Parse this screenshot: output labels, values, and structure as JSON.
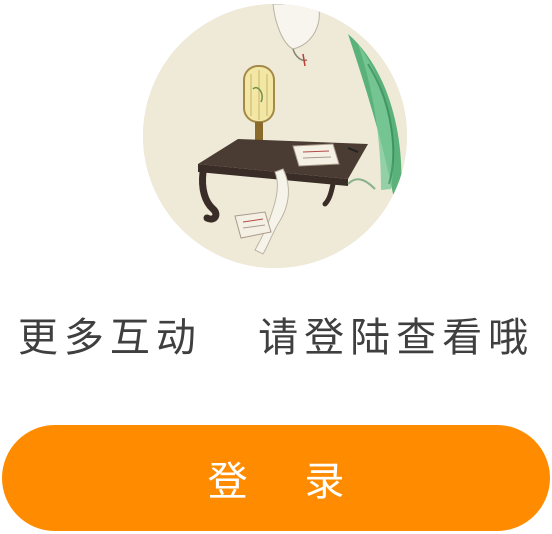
{
  "illustration": {
    "icon": "lantern-desk-illustration",
    "description_hidden": ""
  },
  "prompt": {
    "text": "更多互动   请登陆查看哦"
  },
  "login_button": {
    "label": "登 录",
    "color": "#ff8c00"
  }
}
